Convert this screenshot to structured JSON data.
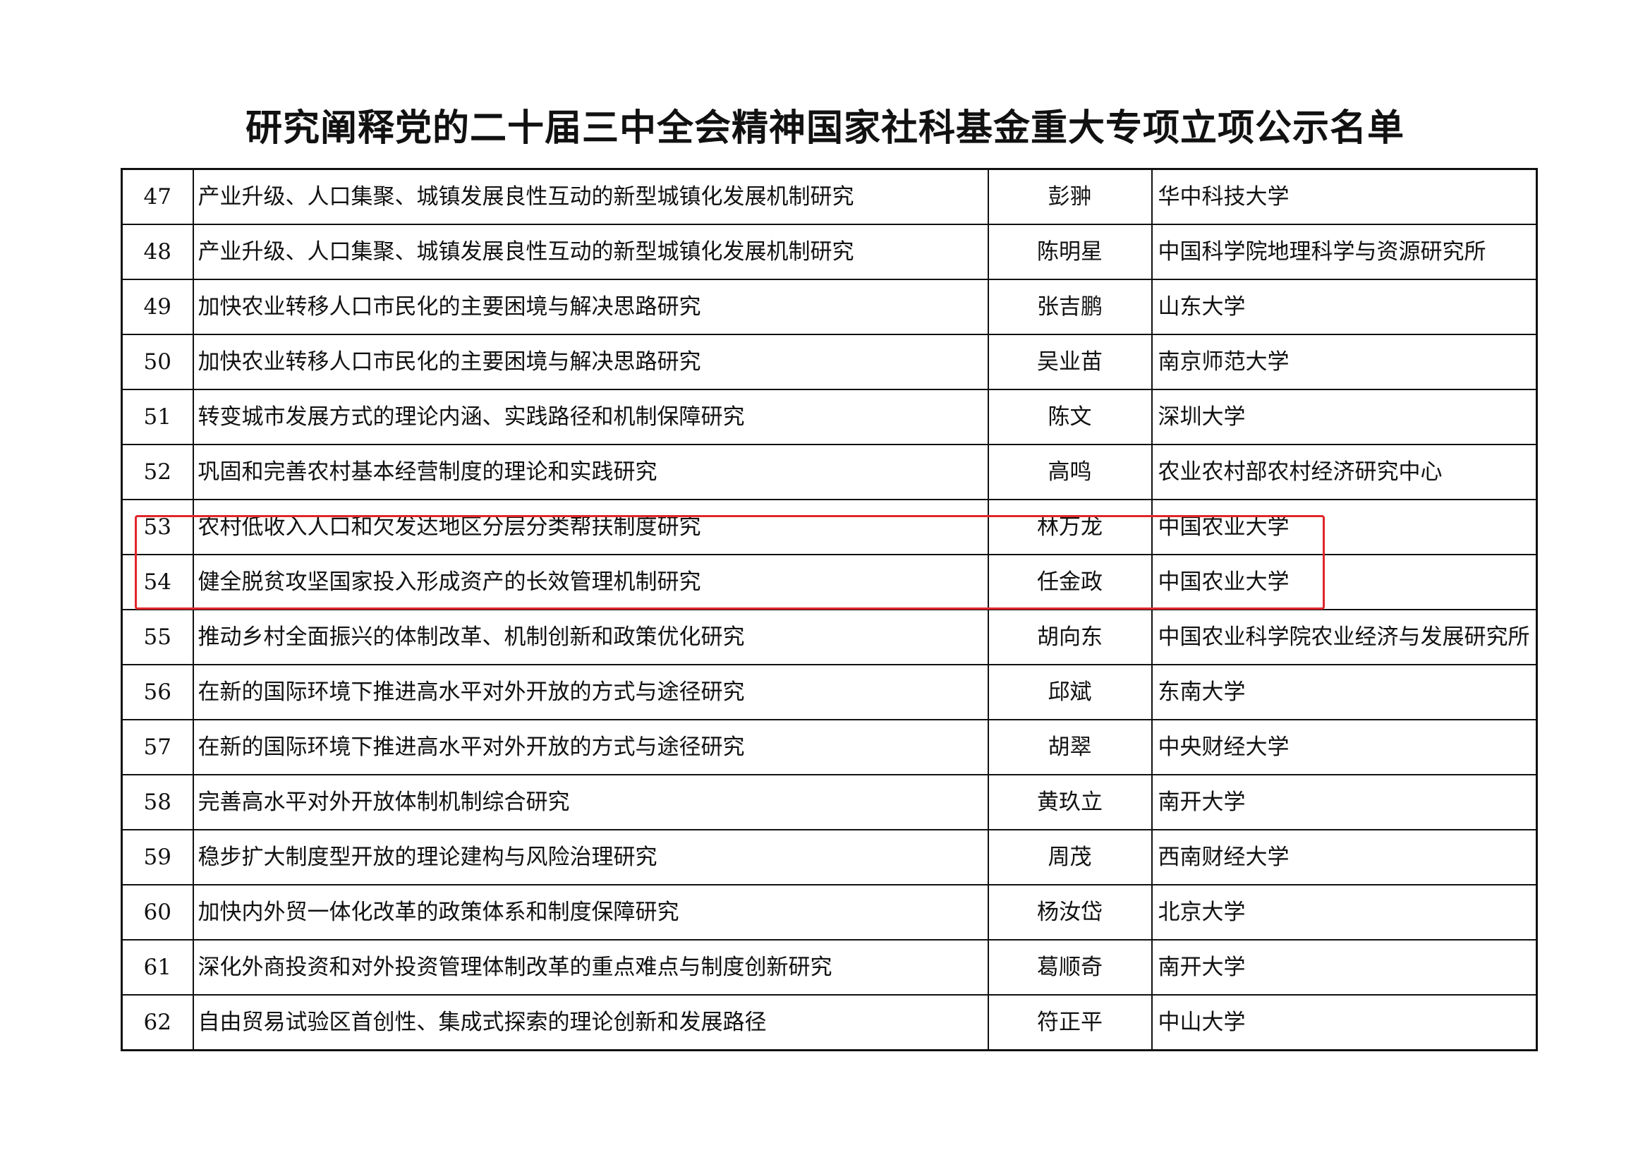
{
  "document": {
    "title": "研究阐释党的二十届三中全会精神国家社科基金重大专项立项公示名单"
  },
  "table": {
    "rows": [
      {
        "num": "47",
        "topic": "产业升级、人口集聚、城镇发展良性互动的新型城镇化发展机制研究",
        "name": "彭翀",
        "institution": "华中科技大学"
      },
      {
        "num": "48",
        "topic": "产业升级、人口集聚、城镇发展良性互动的新型城镇化发展机制研究",
        "name": "陈明星",
        "institution": "中国科学院地理科学与资源研究所"
      },
      {
        "num": "49",
        "topic": "加快农业转移人口市民化的主要困境与解决思路研究",
        "name": "张吉鹏",
        "institution": "山东大学"
      },
      {
        "num": "50",
        "topic": "加快农业转移人口市民化的主要困境与解决思路研究",
        "name": "吴业苗",
        "institution": "南京师范大学"
      },
      {
        "num": "51",
        "topic": "转变城市发展方式的理论内涵、实践路径和机制保障研究",
        "name": "陈文",
        "institution": "深圳大学"
      },
      {
        "num": "52",
        "topic": "巩固和完善农村基本经营制度的理论和实践研究",
        "name": "高鸣",
        "institution": "农业农村部农村经济研究中心"
      },
      {
        "num": "53",
        "topic": "农村低收入人口和欠发达地区分层分类帮扶制度研究",
        "name": "林万龙",
        "institution": "中国农业大学"
      },
      {
        "num": "54",
        "topic": "健全脱贫攻坚国家投入形成资产的长效管理机制研究",
        "name": "任金政",
        "institution": "中国农业大学"
      },
      {
        "num": "55",
        "topic": "推动乡村全面振兴的体制改革、机制创新和政策优化研究",
        "name": "胡向东",
        "institution": "中国农业科学院农业经济与发展研究所"
      },
      {
        "num": "56",
        "topic": "在新的国际环境下推进高水平对外开放的方式与途径研究",
        "name": "邱斌",
        "institution": "东南大学"
      },
      {
        "num": "57",
        "topic": "在新的国际环境下推进高水平对外开放的方式与途径研究",
        "name": "胡翠",
        "institution": "中央财经大学"
      },
      {
        "num": "58",
        "topic": "完善高水平对外开放体制机制综合研究",
        "name": "黄玖立",
        "institution": "南开大学"
      },
      {
        "num": "59",
        "topic": "稳步扩大制度型开放的理论建构与风险治理研究",
        "name": "周茂",
        "institution": "西南财经大学"
      },
      {
        "num": "60",
        "topic": "加快内外贸一体化改革的政策体系和制度保障研究",
        "name": "杨汝岱",
        "institution": "北京大学"
      },
      {
        "num": "61",
        "topic": "深化外商投资和对外投资管理体制改革的重点难点与制度创新研究",
        "name": "葛顺奇",
        "institution": "南开大学"
      },
      {
        "num": "62",
        "topic": "自由贸易试验区首创性、集成式探索的理论创新和发展路径",
        "name": "符正平",
        "institution": "中山大学"
      }
    ]
  },
  "annotation": {
    "highlight_color": "#e0262b"
  }
}
